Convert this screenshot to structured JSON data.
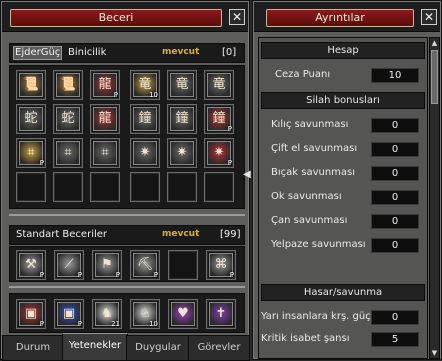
{
  "skills_window": {
    "title": "Beceri",
    "tabs": [
      {
        "label": "Durum"
      },
      {
        "label": "Yetenekler"
      },
      {
        "label": "Duygular"
      },
      {
        "label": "Görevler"
      }
    ],
    "group1": {
      "tab_a": "EjderGüç",
      "tab_b": "Binicilik",
      "points_label": "mevcut",
      "points_value": "0"
    },
    "group2": {
      "title": "Standart Beceriler",
      "points_label": "mevcut",
      "points_value": "99"
    },
    "skill_rows": [
      [
        {
          "icon": "scroll-icon",
          "color": "#a07a3a",
          "badge": ""
        },
        {
          "icon": "scroll-icon",
          "color": "#a07a3a",
          "badge": ""
        },
        {
          "icon": "dragon-fist-icon",
          "color": "#b03030",
          "badge": "P"
        },
        {
          "icon": "winged-dragon-icon",
          "color": "#c8a040",
          "badge": "10"
        },
        {
          "icon": "winged-dragon-icon",
          "color": "#6a6a6a",
          "badge": ""
        },
        {
          "icon": "winged-dragon-icon",
          "color": "#6a6a6a",
          "badge": ""
        }
      ],
      [
        {
          "icon": "coiled-dragon-icon",
          "color": "#6a6a6a",
          "badge": ""
        },
        {
          "icon": "coiled-dragon-icon",
          "color": "#6a6a6a",
          "badge": ""
        },
        {
          "icon": "red-dragon-icon",
          "color": "#b03030",
          "badge": ""
        },
        {
          "icon": "bell-icon",
          "color": "#6a6a6a",
          "badge": ""
        },
        {
          "icon": "bell-icon",
          "color": "#6a6a6a",
          "badge": ""
        },
        {
          "icon": "bell-icon",
          "color": "#b03030",
          "badge": "P"
        }
      ],
      [
        {
          "icon": "lattice-icon",
          "color": "#c8a040",
          "badge": "P"
        },
        {
          "icon": "lattice-icon",
          "color": "#6a6a6a",
          "badge": ""
        },
        {
          "icon": "lattice-icon",
          "color": "#6a6a6a",
          "badge": ""
        },
        {
          "icon": "pinwheel-icon",
          "color": "#6a6a6a",
          "badge": ""
        },
        {
          "icon": "pinwheel-icon",
          "color": "#6a6a6a",
          "badge": ""
        },
        {
          "icon": "pinwheel-icon",
          "color": "#b03030",
          "badge": "P"
        }
      ],
      [
        {
          "icon": "",
          "color": "",
          "badge": ""
        },
        {
          "icon": "",
          "color": "",
          "badge": ""
        },
        {
          "icon": "",
          "color": "",
          "badge": ""
        },
        {
          "icon": "",
          "color": "",
          "badge": ""
        },
        {
          "icon": "",
          "color": "",
          "badge": ""
        },
        {
          "icon": "",
          "color": "",
          "badge": ""
        }
      ]
    ],
    "standard_skills": [
      {
        "icon": "pickaxe-ring-icon",
        "color": "#9a9a9a",
        "badge": "P"
      },
      {
        "icon": "fishing-rod-icon",
        "color": "#9a9a9a",
        "badge": "P"
      },
      {
        "icon": "flag-icon",
        "color": "#9a9a9a",
        "badge": "P"
      },
      {
        "icon": "pickaxe-icon",
        "color": "#9a9a9a",
        "badge": "P"
      },
      {
        "icon": "",
        "color": "",
        "badge": ""
      },
      {
        "icon": "knot-icon",
        "color": "#9a9a9a",
        "badge": "P"
      }
    ],
    "bottom_skills": [
      {
        "icon": "red-book-icon",
        "color": "#b03030",
        "badge": "P"
      },
      {
        "icon": "blue-book-icon",
        "color": "#3050c0",
        "badge": "P"
      },
      {
        "icon": "horse-icon",
        "color": "#d8d8d8",
        "badge": "21"
      },
      {
        "icon": "horse-head-icon",
        "color": "#d8d8d8",
        "badge": "10"
      },
      {
        "icon": "purple-heart-icon",
        "color": "#a040c0",
        "badge": ""
      },
      {
        "icon": "purple-cross-icon",
        "color": "#8040b0",
        "badge": ""
      }
    ]
  },
  "details_window": {
    "title": "Ayrıntılar",
    "sections": {
      "account": "Hesap",
      "weapon": "Silah bonusları",
      "damage": "Hasar/savunma"
    },
    "penalty": {
      "label": "Ceza Puanı",
      "value": "10"
    },
    "weapon_bonuses": [
      {
        "label": "Kılıç savunması",
        "value": "0"
      },
      {
        "label": "Çift el savunması",
        "value": "0"
      },
      {
        "label": "Bıçak savunması",
        "value": "0"
      },
      {
        "label": "Ok savunması",
        "value": "0"
      },
      {
        "label": "Çan savunması",
        "value": "0"
      },
      {
        "label": "Yelpaze savunması",
        "value": "0"
      }
    ],
    "damage_stats": [
      {
        "label": "Yarı insanlara krş. güç",
        "value": "0"
      },
      {
        "label": "Kritik isabet şansı",
        "value": "5"
      }
    ]
  }
}
